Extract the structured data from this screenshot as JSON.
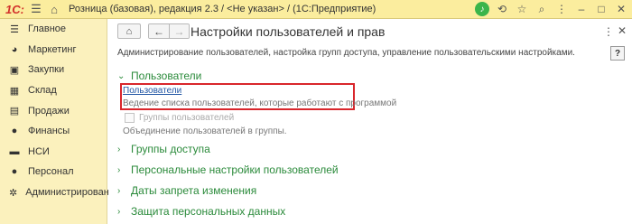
{
  "titlebar": {
    "logo": "1С:",
    "title": "Розница (базовая), редакция 2.3 / <Не указан> / (1С:Предприятие)",
    "icons": [
      "menu-icon",
      "home-icon",
      "bell-icon",
      "history-icon",
      "star-icon",
      "search-icon",
      "more-icon",
      "minimize-icon",
      "maximize-icon",
      "close-icon"
    ]
  },
  "sidebar": {
    "items": [
      {
        "label": "Главное",
        "icon": "menu-icon"
      },
      {
        "label": "Маркетинг",
        "icon": "marketing-icon"
      },
      {
        "label": "Закупки",
        "icon": "cart-icon"
      },
      {
        "label": "Склад",
        "icon": "warehouse-icon"
      },
      {
        "label": "Продажи",
        "icon": "sales-icon"
      },
      {
        "label": "Финансы",
        "icon": "finance-icon"
      },
      {
        "label": "НСИ",
        "icon": "catalog-icon"
      },
      {
        "label": "Персонал",
        "icon": "person-icon"
      },
      {
        "label": "Администрирование",
        "icon": "gear-icon"
      }
    ]
  },
  "main": {
    "title": "Настройки пользователей и прав",
    "description": "Администрирование пользователей, настройка групп доступа, управление пользовательскими настройками.",
    "help_label": "?",
    "sections": [
      {
        "label": "Пользователи",
        "expanded": true
      },
      {
        "label": "Группы доступа",
        "expanded": false
      },
      {
        "label": "Персональные настройки пользователей",
        "expanded": false
      },
      {
        "label": "Даты запрета изменения",
        "expanded": false
      },
      {
        "label": "Защита персональных данных",
        "expanded": false
      }
    ],
    "users_link": "Пользователи",
    "users_desc": "Ведение списка пользователей, которые работают с программой",
    "groups_checkbox_label": "Группы пользователей",
    "groups_checked": false,
    "groups_desc": "Объединение пользователей в группы."
  },
  "colors": {
    "titlebar_bg": "#fbed9e",
    "sidebar_bg": "#fbf1bd",
    "section_green": "#2a8a3a",
    "link_blue": "#2055a4",
    "highlight_red": "#d9262c"
  }
}
